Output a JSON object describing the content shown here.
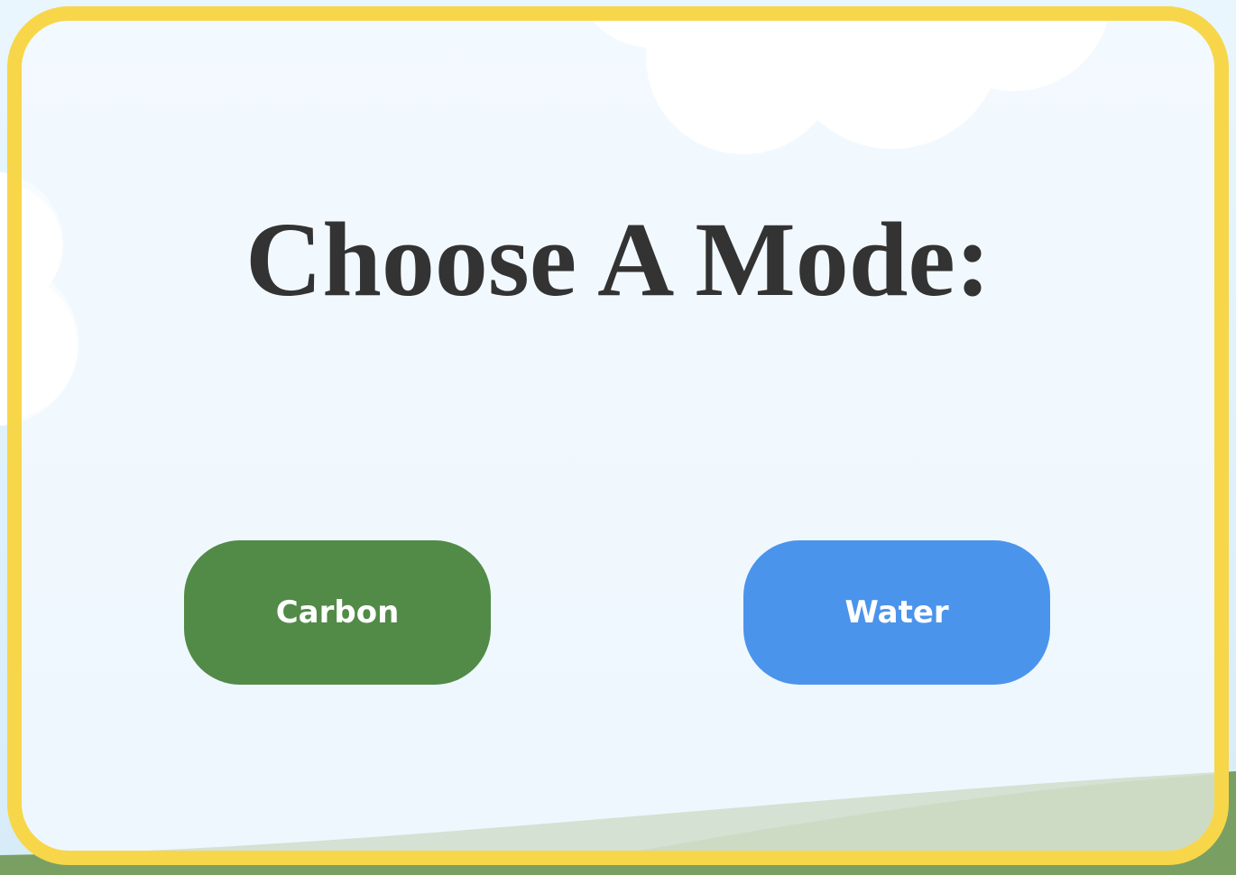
{
  "title": "Choose A Mode:",
  "buttons": {
    "carbon": {
      "label": "Carbon",
      "color": "#518b47"
    },
    "water": {
      "label": "Water",
      "color": "#4b94ec"
    }
  },
  "theme": {
    "frame_color": "#f7d64a",
    "title_color": "#333333",
    "sky_color": "#eaf6fd",
    "grass_color": "#7a9f63"
  }
}
